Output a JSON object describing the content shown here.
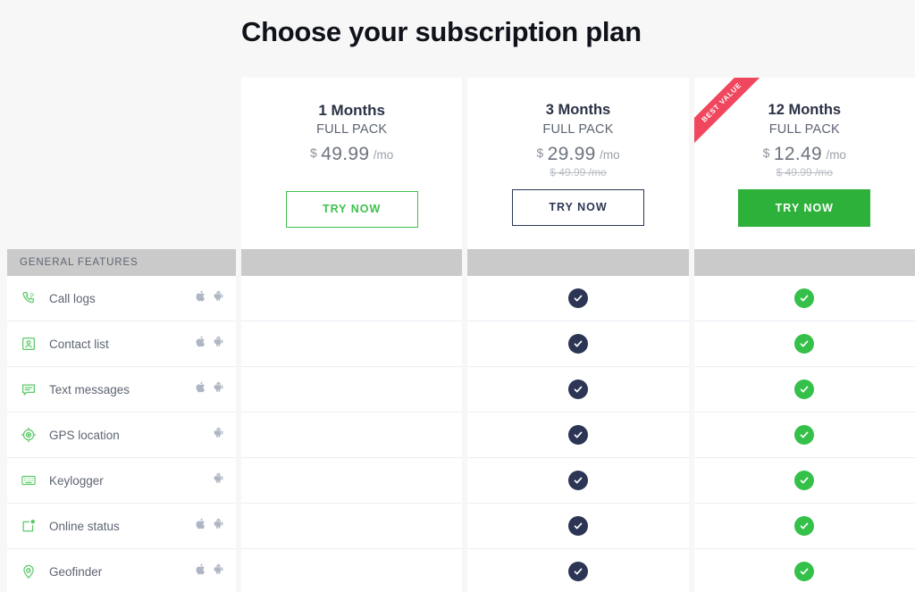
{
  "header": {
    "title": "Choose your subscription plan"
  },
  "colors": {
    "page_background": "#f7f7f8",
    "accent_green": "#3fc14e",
    "solid_green": "#2eb13a",
    "navy": "#2c3654",
    "ribbon_red": "#f0475f",
    "section_bar_gray": "#cacaca",
    "check_navy": "#2c3654",
    "check_green": "#35c04a"
  },
  "plans": [
    {
      "name": "1 Months",
      "subtitle": "FULL PACK",
      "currency": "$",
      "price": "49.99",
      "period": "/mo",
      "old_price": "",
      "cta_label": "TRY NOW",
      "cta_style": "outline-green",
      "ribbon": ""
    },
    {
      "name": "3 Months",
      "subtitle": "FULL PACK",
      "currency": "$",
      "price": "29.99",
      "period": "/mo",
      "old_price": "$ 49.99 /mo",
      "cta_label": "TRY NOW",
      "cta_style": "outline-navy",
      "ribbon": ""
    },
    {
      "name": "12 Months",
      "subtitle": "FULL PACK",
      "currency": "$",
      "price": "12.49",
      "period": "/mo",
      "old_price": "$ 49.99 /mo",
      "cta_label": "TRY NOW",
      "cta_style": "solid-green",
      "ribbon": "BEST VALUE"
    }
  ],
  "comparison": {
    "section_label": "GENERAL FEATURES",
    "features": [
      {
        "label": "Call logs",
        "icon": "phone-call-icon",
        "platforms": [
          "apple",
          "android"
        ],
        "availability": [
          "none",
          "navy-check",
          "green-check"
        ]
      },
      {
        "label": "Contact list",
        "icon": "contact-card-icon",
        "platforms": [
          "apple",
          "android"
        ],
        "availability": [
          "none",
          "navy-check",
          "green-check"
        ]
      },
      {
        "label": "Text messages",
        "icon": "message-bubble-icon",
        "platforms": [
          "apple",
          "android"
        ],
        "availability": [
          "none",
          "navy-check",
          "green-check"
        ]
      },
      {
        "label": "GPS location",
        "icon": "gps-target-icon",
        "platforms": [
          "android"
        ],
        "availability": [
          "none",
          "navy-check",
          "green-check"
        ]
      },
      {
        "label": "Keylogger",
        "icon": "keyboard-icon",
        "platforms": [
          "android"
        ],
        "availability": [
          "none",
          "navy-check",
          "green-check"
        ]
      },
      {
        "label": "Online status",
        "icon": "online-status-icon",
        "platforms": [
          "apple",
          "android"
        ],
        "availability": [
          "none",
          "navy-check",
          "green-check"
        ]
      },
      {
        "label": "Geofinder",
        "icon": "geofinder-pin-icon",
        "platforms": [
          "apple",
          "android"
        ],
        "availability": [
          "none",
          "navy-check",
          "green-check"
        ]
      }
    ]
  }
}
